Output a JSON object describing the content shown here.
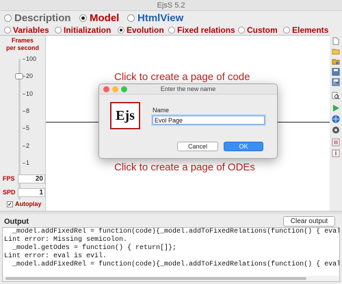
{
  "window": {
    "title": "EjsS 5.2"
  },
  "main_tabs": [
    {
      "label": "Description",
      "selected": false
    },
    {
      "label": "Model",
      "selected": true
    },
    {
      "label": "HtmlView",
      "selected": false
    }
  ],
  "sub_tabs": [
    {
      "label": "Variables",
      "selected": false
    },
    {
      "label": "Initialization",
      "selected": false
    },
    {
      "label": "Evolution",
      "selected": true
    },
    {
      "label": "Fixed relations",
      "selected": false
    },
    {
      "label": "Custom",
      "selected": false
    },
    {
      "label": "Elements",
      "selected": false
    }
  ],
  "side_panel": {
    "title_line1": "Frames",
    "title_line2": "per second",
    "ticks": [
      "100",
      "20",
      "10",
      "8",
      "5",
      "2",
      "1"
    ],
    "slider_value": "20",
    "fps_label": "FPS",
    "fps_value": "20",
    "spd_label": "SPD",
    "spd_value": "1",
    "autoplay_label": "Autoplay",
    "autoplay_checked": true
  },
  "editor": {
    "prompt_code": "Click to create a page of code",
    "prompt_odes": "Click to create a page of ODEs"
  },
  "toolbar_icons": [
    "new-file-icon",
    "open-folder-icon",
    "open-examples-icon",
    "save-icon",
    "save-as-icon",
    "search-icon",
    "run-icon",
    "web-icon",
    "package-icon",
    "settings-icon",
    "info-icon"
  ],
  "output": {
    "label": "Output",
    "clear_button": "Clear output",
    "lines": [
      "  _model.addFixedRel = function(code){_model.addToFixedRelations(function() { eval(code);",
      "Lint error: Missing semicolon.",
      "  _model.getOdes = function() { return[]};",
      "Lint error: eval is evil.",
      "  _model.addFixedRel = function(code){_model.addToFixedRelations(function() { eval(code);"
    ]
  },
  "dialog": {
    "title": "Enter the new name",
    "logo_text": "Ejs",
    "name_label": "Name",
    "name_value": "Evol Page",
    "cancel_label": "Cancel",
    "ok_label": "OK"
  },
  "colors": {
    "accent_red": "#b00000",
    "link_blue": "#1d5fb0",
    "ok_blue": "#3a8ff5",
    "close_light": "#fc605b",
    "minimize_light": "#fdbc40",
    "zoom_light": "#34c84a"
  }
}
